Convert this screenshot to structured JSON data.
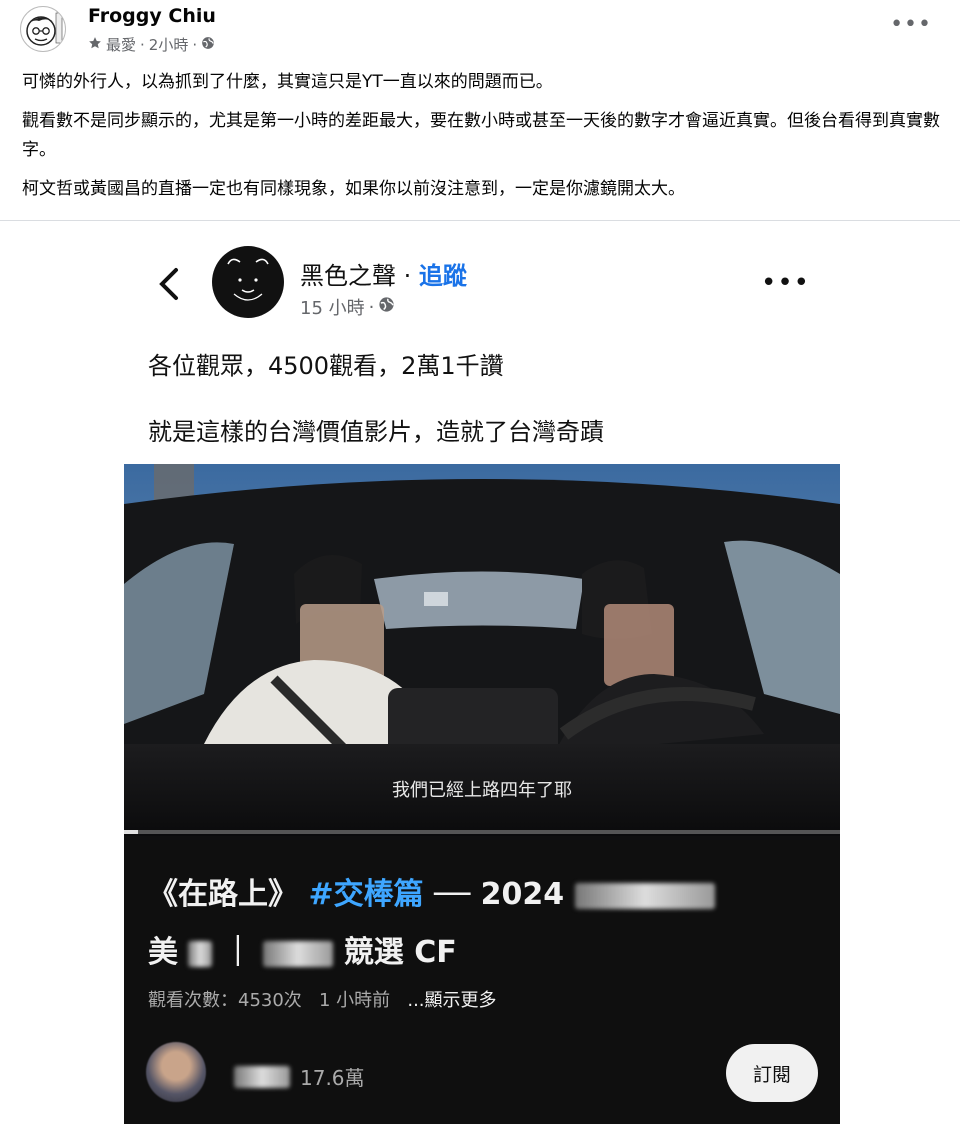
{
  "post": {
    "author": "Froggy Chiu",
    "audience": "最愛",
    "time": "2小時",
    "paragraphs": [
      "可憐的外行人，以為抓到了什麼，其實這只是YT一直以來的問題而已。",
      "觀看數不是同步顯示的，尤其是第一小時的差距最大，要在數小時或甚至一天後的數字才會逼近真實。但後台看得到真實數字。",
      "柯文哲或黃國昌的直播一定也有同樣現象，如果你以前沒注意到，一定是你濾鏡開太大。"
    ]
  },
  "shared": {
    "page_name": "黑色之聲",
    "follow": "追蹤",
    "time": "15 小時",
    "line1": "各位觀眾，4500觀看，2萬1千讚",
    "line2": "就是這樣的台灣價值影片，造就了台灣奇蹟",
    "video": {
      "subtitle": "我們已經上路四年了耶",
      "progress_pct": 2,
      "title_part1": "《在路上》",
      "hashtag": "#交棒篇",
      "title_part2": "── 2024",
      "title_part3": "美",
      "title_part4": "競選 CF",
      "views": "觀看次數：4530次",
      "ago": "1 小時前",
      "show_more": "...顯示更多",
      "subscribers": "17.6萬",
      "subscribe": "訂閱"
    }
  },
  "icons": {
    "star": "star-icon",
    "globe": "globe-icon",
    "more": "more-dots-icon",
    "back": "chevron-left-icon"
  }
}
